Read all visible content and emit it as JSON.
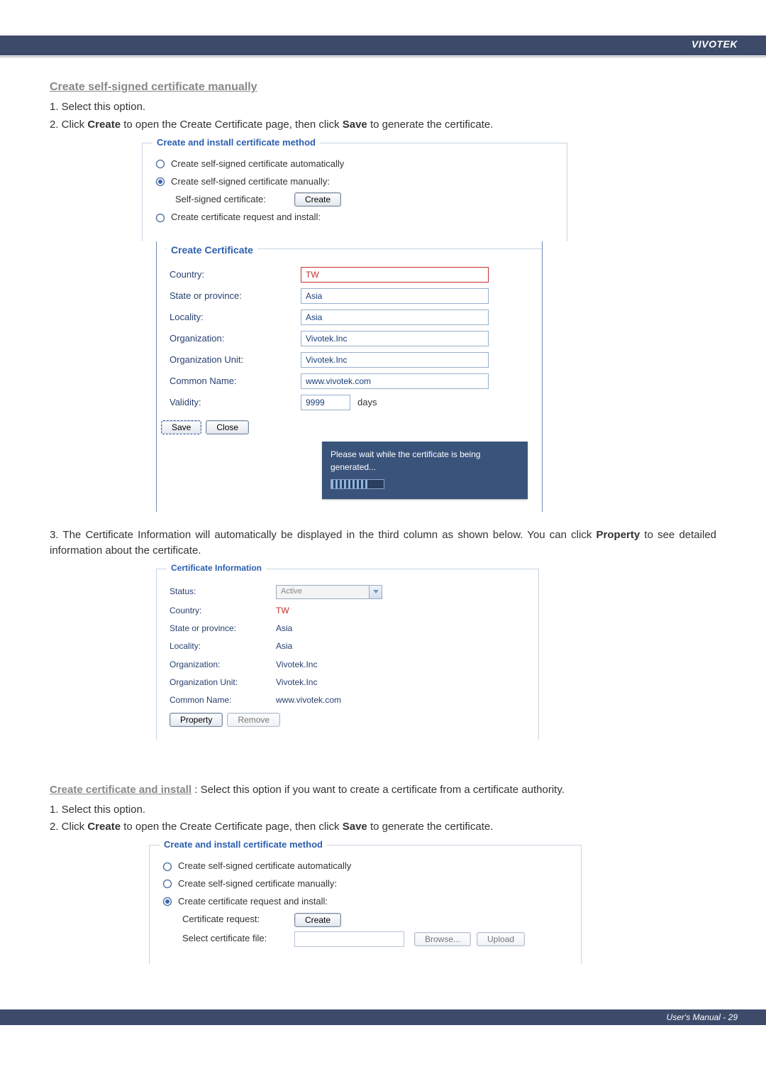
{
  "brand": "VIVOTEK",
  "section1": {
    "title": "Create self-signed certificate manually",
    "step1": "1. Select this option.",
    "step2_pre": "2. Click ",
    "step2_b1": "Create",
    "step2_mid": " to open the Create Certificate page, then click ",
    "step2_b2": "Save",
    "step2_post": " to generate the certificate."
  },
  "panel_method": {
    "legend": "Create and install certificate method",
    "opt_auto": "Create self-signed certificate automatically",
    "opt_manual": "Create self-signed certificate manually:",
    "self_signed_label": "Self-signed certificate:",
    "create_btn": "Create",
    "opt_request": "Create certificate request and install:"
  },
  "panel_cert": {
    "legend": "Create Certificate",
    "country_l": "Country:",
    "country_v": "TW",
    "state_l": "State or province:",
    "state_v": "Asia",
    "locality_l": "Locality:",
    "locality_v": "Asia",
    "org_l": "Organization:",
    "org_v": "Vivotek.Inc",
    "ou_l": "Organization Unit:",
    "ou_v": "Vivotek.Inc",
    "cn_l": "Common Name:",
    "cn_v": "www.vivotek.com",
    "validity_l": "Validity:",
    "validity_v": "9999",
    "validity_unit": "days",
    "save_btn": "Save",
    "close_btn": "Close",
    "wait_msg": "Please wait while the certificate is being generated..."
  },
  "para3_pre": "3. The Certificate Information will automatically be displayed in the third column as shown below. You can click ",
  "para3_b": "Property",
  "para3_post": " to see detailed information about the certificate.",
  "panel_info": {
    "legend": "Certificate Information",
    "status_l": "Status:",
    "status_v": "Active",
    "country_l": "Country:",
    "country_v": "TW",
    "state_l": "State or province:",
    "state_v": "Asia",
    "locality_l": "Locality:",
    "locality_v": "Asia",
    "org_l": "Organization:",
    "org_v": "Vivotek.Inc",
    "ou_l": "Organization Unit:",
    "ou_v": "Vivotek.Inc",
    "cn_l": "Common Name:",
    "cn_v": "www.vivotek.com",
    "property_btn": "Property",
    "remove_btn": "Remove"
  },
  "section2": {
    "title": "Create certificate and install",
    "desc": " :  Select this option if you want to create a certificate from a certificate authority.",
    "step1": "1. Select this option.",
    "step2_pre": "2. Click ",
    "step2_b1": "Create",
    "step2_mid": " to open the Create Certificate page, then click ",
    "step2_b2": "Save",
    "step2_post": " to generate the certificate."
  },
  "panel_method2": {
    "legend": "Create and install certificate method",
    "opt_auto": "Create self-signed certificate automatically",
    "opt_manual": "Create self-signed certificate manually:",
    "opt_request": "Create certificate request and install:",
    "cert_req_label": "Certificate request:",
    "create_btn": "Create",
    "select_file_label": "Select certificate file:",
    "browse_btn": "Browse...",
    "upload_btn": "Upload"
  },
  "footer": "User's Manual - 29"
}
